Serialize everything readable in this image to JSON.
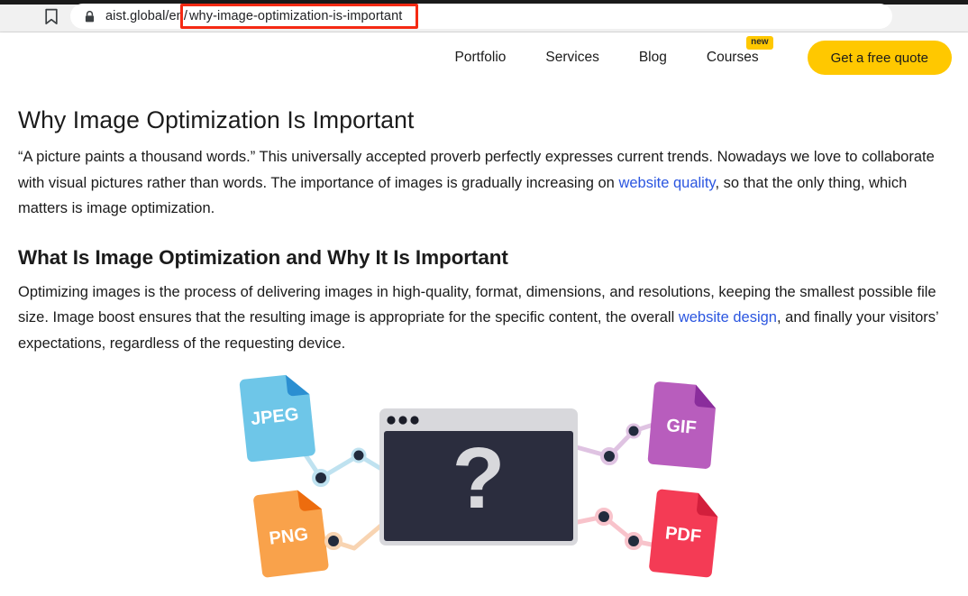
{
  "browser": {
    "bookmark_icon": "bookmark-icon",
    "lock_icon": "lock-icon",
    "url_origin": "aist.global/en/",
    "url_highlighted": "why-image-optimization-is-important",
    "url_full": "aist.global/en/why-image-optimization-is-important",
    "highlight_color": "#f52a13"
  },
  "nav": {
    "items": [
      {
        "label": "Portfolio"
      },
      {
        "label": "Services"
      },
      {
        "label": "Blog"
      },
      {
        "label": "Courses",
        "badge": "new"
      }
    ],
    "cta_label": "Get a free quote",
    "cta_color": "#ffc800",
    "badge_color": "#ffc800"
  },
  "article": {
    "title": "Why Image Optimization Is Important",
    "paragraph1_part1": "“A picture paints a thousand words.” This universally accepted proverb perfectly expresses current trends. Nowadays we love to collaborate with visual pictures rather than words. The importance of images is gradually increasing on ",
    "paragraph1_link": "website quality",
    "paragraph1_part2": ", so that the only thing, which matters is image optimization.",
    "section_heading": "What Is Image Optimization and Why It Is Important",
    "paragraph2_part1": "Optimizing images is the process of delivering images in high-quality, format, dimensions, and resolutions, keeping the smallest possible file size. Image boost ensures that the resulting image is appropriate for the specific content, the overall ",
    "paragraph2_link": "website design",
    "paragraph2_part2": ", and finally your visitors’ expectations, regardless of the requesting device.",
    "link_color": "#2b56e0"
  },
  "illustration": {
    "alt": "Image format conversion illustration",
    "center": {
      "name": "browser-window-placeholder",
      "glyph": "?",
      "titlebar_color": "#d8d8dc",
      "body_color": "#2b2d3e",
      "glyph_color": "#d8d8dc"
    },
    "file_cards": [
      {
        "label": "JPEG",
        "color": "#6ec6e8",
        "fold_color": "#2b8fd1",
        "position": "top-left"
      },
      {
        "label": "PNG",
        "color": "#f9a24b",
        "fold_color": "#ed6c0e",
        "position": "bottom-left"
      },
      {
        "label": "GIF",
        "color": "#b85dbd",
        "fold_color": "#8a2d9c",
        "position": "top-right"
      },
      {
        "label": "PDF",
        "color": "#f43b55",
        "fold_color": "#d21f3c",
        "position": "bottom-right"
      }
    ]
  }
}
